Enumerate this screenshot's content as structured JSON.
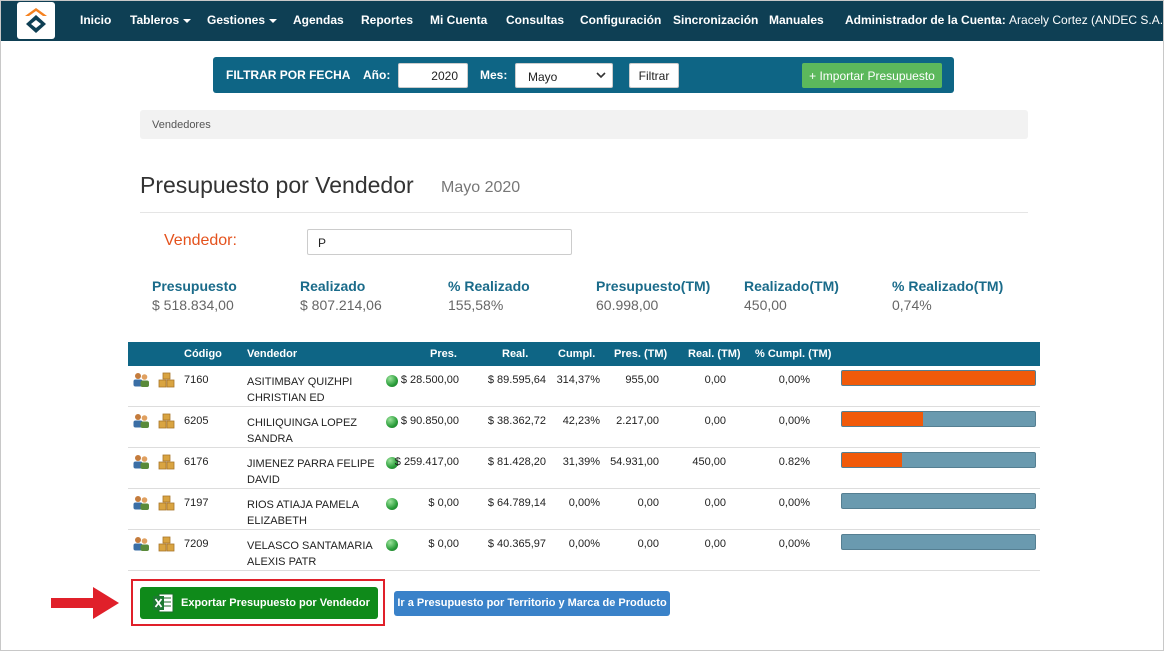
{
  "navbar": {
    "items": [
      "Inicio",
      "Tableros",
      "Gestiones",
      "Agendas",
      "Reportes",
      "Mi Cuenta",
      "Consultas",
      "Configuración",
      "Sincronización",
      "Manuales"
    ],
    "account_label": "Administrador de la Cuenta:",
    "account_user": "Aracely Cortez (ANDEC S.A.)"
  },
  "filter": {
    "title": "FILTRAR POR FECHA",
    "year_label": "Año:",
    "year_value": "2020",
    "month_label": "Mes:",
    "month_value": "Mayo",
    "filter_button": "Filtrar",
    "import_button": "+ Importar Presupuesto"
  },
  "breadcrumb": "Vendedores",
  "page": {
    "title": "Presupuesto por Vendedor",
    "subtitle": "Mayo 2020"
  },
  "vendor_filter": {
    "label": "Vendedor:",
    "value": "P"
  },
  "summary": {
    "presupuesto_label": "Presupuesto",
    "presupuesto": "$ 518.834,00",
    "realizado_label": "Realizado",
    "realizado": "$ 807.214,06",
    "pct_label": "% Realizado",
    "pct": "155,58%",
    "presupuesto_tm_label": "Presupuesto(TM)",
    "presupuesto_tm": "60.998,00",
    "realizado_tm_label": "Realizado(TM)",
    "realizado_tm": "450,00",
    "pct_tm_label": "% Realizado(TM)",
    "pct_tm": "0,74%"
  },
  "table": {
    "headers": {
      "codigo": "Código",
      "vendedor": "Vendedor",
      "pres": "Pres.",
      "real": "Real.",
      "cumpl": "Cumpl.",
      "pres_tm": "Pres. (TM)",
      "real_tm": "Real. (TM)",
      "cumpl_tm": "% Cumpl. (TM)"
    },
    "rows": [
      {
        "codigo": "7160",
        "vendedor": "ASITIMBAY QUIZHPI CHRISTIAN ED",
        "pres": "$ 28.500,00",
        "real": "$ 89.595,64",
        "cumpl": "314,37%",
        "pres_tm": "955,00",
        "real_tm": "0,00",
        "cumpl_tm": "0,00%",
        "progress": 1.0
      },
      {
        "codigo": "6205",
        "vendedor": "CHILIQUINGA LOPEZ SANDRA",
        "pres": "$ 90.850,00",
        "real": "$ 38.362,72",
        "cumpl": "42,23%",
        "pres_tm": "2.217,00",
        "real_tm": "0,00",
        "cumpl_tm": "0,00%",
        "progress": 0.42
      },
      {
        "codigo": "6176",
        "vendedor": "JIMENEZ PARRA FELIPE DAVID",
        "pres": "$ 259.417,00",
        "real": "$ 81.428,20",
        "cumpl": "31,39%",
        "pres_tm": "54.931,00",
        "real_tm": "450,00",
        "cumpl_tm": "0.82%",
        "progress": 0.31
      },
      {
        "codigo": "7197",
        "vendedor": "RIOS ATIAJA PAMELA ELIZABETH",
        "pres": "$ 0,00",
        "real": "$ 64.789,14",
        "cumpl": "0,00%",
        "pres_tm": "0,00",
        "real_tm": "0,00",
        "cumpl_tm": "0,00%",
        "progress": 0
      },
      {
        "codigo": "7209",
        "vendedor": "VELASCO SANTAMARIA ALEXIS PATR",
        "pres": "$ 0,00",
        "real": "$ 40.365,97",
        "cumpl": "0,00%",
        "pres_tm": "0,00",
        "real_tm": "0,00",
        "cumpl_tm": "0,00%",
        "progress": 0
      }
    ]
  },
  "buttons": {
    "export": "Exportar Presupuesto por Vendedor",
    "territory": "Ir a Presupuesto por Territorio y Marca de Producto"
  },
  "colors": {
    "navbar": "#0e3f54",
    "header_blue": "#0e6585",
    "progress_fill": "#f05a0a",
    "progress_track": "#6a9aaf",
    "export_green": "#0f8a1a",
    "highlight_red": "#e0202a"
  },
  "icons": [
    "users-icon",
    "boxes-icon",
    "status-dot-icon",
    "excel-icon",
    "arrow-right-icon"
  ]
}
